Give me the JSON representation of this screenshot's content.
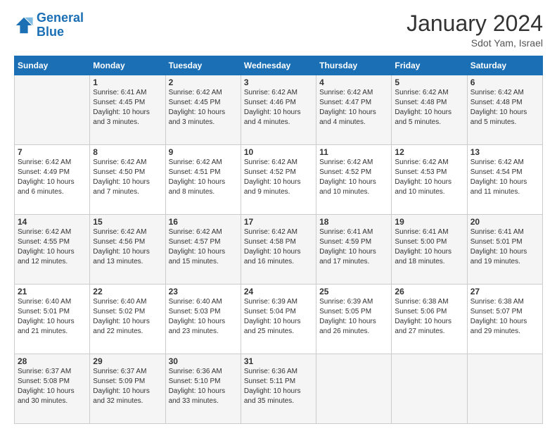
{
  "logo": {
    "text_general": "General",
    "text_blue": "Blue"
  },
  "header": {
    "title": "January 2024",
    "subtitle": "Sdot Yam, Israel"
  },
  "weekdays": [
    "Sunday",
    "Monday",
    "Tuesday",
    "Wednesday",
    "Thursday",
    "Friday",
    "Saturday"
  ],
  "weeks": [
    [
      null,
      {
        "day": "1",
        "sunrise": "6:41 AM",
        "sunset": "4:45 PM",
        "daylight": "10 hours and 3 minutes."
      },
      {
        "day": "2",
        "sunrise": "6:42 AM",
        "sunset": "4:45 PM",
        "daylight": "10 hours and 3 minutes."
      },
      {
        "day": "3",
        "sunrise": "6:42 AM",
        "sunset": "4:46 PM",
        "daylight": "10 hours and 4 minutes."
      },
      {
        "day": "4",
        "sunrise": "6:42 AM",
        "sunset": "4:47 PM",
        "daylight": "10 hours and 4 minutes."
      },
      {
        "day": "5",
        "sunrise": "6:42 AM",
        "sunset": "4:48 PM",
        "daylight": "10 hours and 5 minutes."
      },
      {
        "day": "6",
        "sunrise": "6:42 AM",
        "sunset": "4:48 PM",
        "daylight": "10 hours and 5 minutes."
      }
    ],
    [
      {
        "day": "7",
        "sunrise": "6:42 AM",
        "sunset": "4:49 PM",
        "daylight": "10 hours and 6 minutes."
      },
      {
        "day": "8",
        "sunrise": "6:42 AM",
        "sunset": "4:50 PM",
        "daylight": "10 hours and 7 minutes."
      },
      {
        "day": "9",
        "sunrise": "6:42 AM",
        "sunset": "4:51 PM",
        "daylight": "10 hours and 8 minutes."
      },
      {
        "day": "10",
        "sunrise": "6:42 AM",
        "sunset": "4:52 PM",
        "daylight": "10 hours and 9 minutes."
      },
      {
        "day": "11",
        "sunrise": "6:42 AM",
        "sunset": "4:52 PM",
        "daylight": "10 hours and 10 minutes."
      },
      {
        "day": "12",
        "sunrise": "6:42 AM",
        "sunset": "4:53 PM",
        "daylight": "10 hours and 10 minutes."
      },
      {
        "day": "13",
        "sunrise": "6:42 AM",
        "sunset": "4:54 PM",
        "daylight": "10 hours and 11 minutes."
      }
    ],
    [
      {
        "day": "14",
        "sunrise": "6:42 AM",
        "sunset": "4:55 PM",
        "daylight": "10 hours and 12 minutes."
      },
      {
        "day": "15",
        "sunrise": "6:42 AM",
        "sunset": "4:56 PM",
        "daylight": "10 hours and 13 minutes."
      },
      {
        "day": "16",
        "sunrise": "6:42 AM",
        "sunset": "4:57 PM",
        "daylight": "10 hours and 15 minutes."
      },
      {
        "day": "17",
        "sunrise": "6:42 AM",
        "sunset": "4:58 PM",
        "daylight": "10 hours and 16 minutes."
      },
      {
        "day": "18",
        "sunrise": "6:41 AM",
        "sunset": "4:59 PM",
        "daylight": "10 hours and 17 minutes."
      },
      {
        "day": "19",
        "sunrise": "6:41 AM",
        "sunset": "5:00 PM",
        "daylight": "10 hours and 18 minutes."
      },
      {
        "day": "20",
        "sunrise": "6:41 AM",
        "sunset": "5:01 PM",
        "daylight": "10 hours and 19 minutes."
      }
    ],
    [
      {
        "day": "21",
        "sunrise": "6:40 AM",
        "sunset": "5:01 PM",
        "daylight": "10 hours and 21 minutes."
      },
      {
        "day": "22",
        "sunrise": "6:40 AM",
        "sunset": "5:02 PM",
        "daylight": "10 hours and 22 minutes."
      },
      {
        "day": "23",
        "sunrise": "6:40 AM",
        "sunset": "5:03 PM",
        "daylight": "10 hours and 23 minutes."
      },
      {
        "day": "24",
        "sunrise": "6:39 AM",
        "sunset": "5:04 PM",
        "daylight": "10 hours and 25 minutes."
      },
      {
        "day": "25",
        "sunrise": "6:39 AM",
        "sunset": "5:05 PM",
        "daylight": "10 hours and 26 minutes."
      },
      {
        "day": "26",
        "sunrise": "6:38 AM",
        "sunset": "5:06 PM",
        "daylight": "10 hours and 27 minutes."
      },
      {
        "day": "27",
        "sunrise": "6:38 AM",
        "sunset": "5:07 PM",
        "daylight": "10 hours and 29 minutes."
      }
    ],
    [
      {
        "day": "28",
        "sunrise": "6:37 AM",
        "sunset": "5:08 PM",
        "daylight": "10 hours and 30 minutes."
      },
      {
        "day": "29",
        "sunrise": "6:37 AM",
        "sunset": "5:09 PM",
        "daylight": "10 hours and 32 minutes."
      },
      {
        "day": "30",
        "sunrise": "6:36 AM",
        "sunset": "5:10 PM",
        "daylight": "10 hours and 33 minutes."
      },
      {
        "day": "31",
        "sunrise": "6:36 AM",
        "sunset": "5:11 PM",
        "daylight": "10 hours and 35 minutes."
      },
      null,
      null,
      null
    ]
  ],
  "labels": {
    "sunrise": "Sunrise:",
    "sunset": "Sunset:",
    "daylight": "Daylight:"
  }
}
